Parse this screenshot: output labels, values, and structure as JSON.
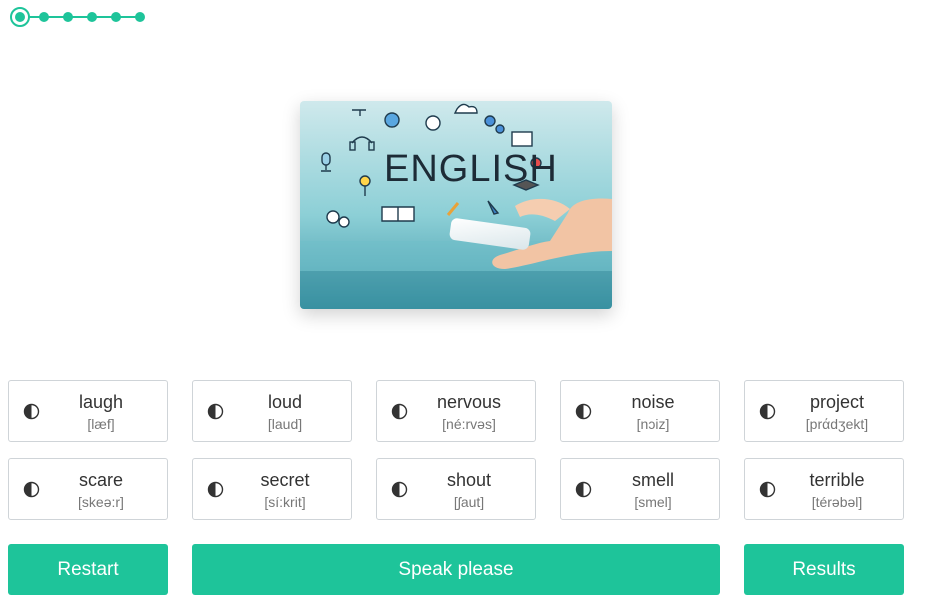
{
  "progress": {
    "total_steps": 6,
    "current_step": 1
  },
  "illustration": {
    "heading": "ENGLISH"
  },
  "words": [
    {
      "word": "laugh",
      "transcription": "[læf]"
    },
    {
      "word": "loud",
      "transcription": "[laud]"
    },
    {
      "word": "nervous",
      "transcription": "[né:rvəs]"
    },
    {
      "word": "noise",
      "transcription": "[nɔiz]"
    },
    {
      "word": "project",
      "transcription": "[prάdʒekt]"
    },
    {
      "word": "scare",
      "transcription": "[skeə:r]"
    },
    {
      "word": "secret",
      "transcription": "[sí:krit]"
    },
    {
      "word": "shout",
      "transcription": "[ʃaut]"
    },
    {
      "word": "smell",
      "transcription": "[smel]"
    },
    {
      "word": "terrible",
      "transcription": "[térəbəl]"
    }
  ],
  "actions": {
    "restart": "Restart",
    "speak": "Speak please",
    "results": "Results"
  },
  "icons": {
    "word_audio": "speaker-icon"
  },
  "colors": {
    "accent": "#1ec49a",
    "card_border": "#cfd4d8",
    "text": "#333333",
    "transcription": "#777777"
  }
}
